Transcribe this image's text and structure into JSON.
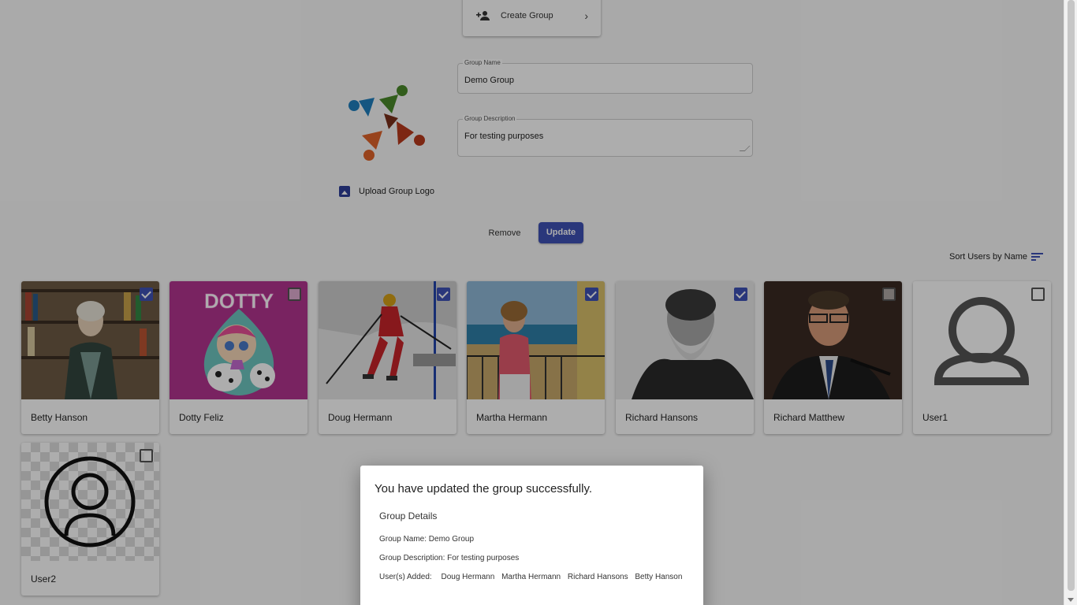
{
  "header": {
    "create_group_label": "Create Group"
  },
  "form": {
    "group_name_label": "Group Name",
    "group_name_value": "Demo Group",
    "group_description_label": "Group Description",
    "group_description_value": "For testing purposes",
    "upload_logo_label": "Upload Group Logo",
    "remove_label": "Remove",
    "update_label": "Update"
  },
  "sort": {
    "label": "Sort Users by Name"
  },
  "users": [
    {
      "name": "Betty Hanson",
      "checked": true
    },
    {
      "name": "Dotty Feliz",
      "checked": false,
      "photo_text": "DOTTY"
    },
    {
      "name": "Doug Hermann",
      "checked": true
    },
    {
      "name": "Martha Hermann",
      "checked": true
    },
    {
      "name": "Richard Hansons",
      "checked": true
    },
    {
      "name": "Richard Matthew",
      "checked": false
    },
    {
      "name": "User1",
      "checked": false
    },
    {
      "name": "User2",
      "checked": false
    }
  ],
  "dialog": {
    "title": "You have updated the group successfully.",
    "subtitle": "Group Details",
    "name_line": "Group Name: Demo Group",
    "description_line": "Group Description: For testing purposes",
    "users_added_label": "User(s) Added:",
    "users_added": [
      "Doug Hermann",
      "Martha Hermann",
      "Richard Hansons",
      "Betty Hanson"
    ]
  },
  "colors": {
    "primary": "#3f51b5",
    "overlay": "rgba(0,0,0,0.32)"
  }
}
